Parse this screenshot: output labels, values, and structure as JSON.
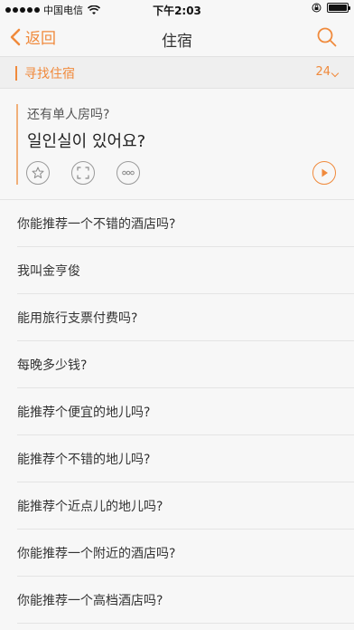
{
  "status_bar": {
    "carrier": "中国电信",
    "time": "下午2:03"
  },
  "nav": {
    "back_label": "返回",
    "title": "住宿"
  },
  "section": {
    "title": "寻找住宿",
    "count": "24"
  },
  "featured": {
    "chinese": "还有单人房吗?",
    "korean": "일인실이 있어요?"
  },
  "list": {
    "items": [
      "你能推荐一个不错的酒店吗?",
      "我叫金亨俊",
      "能用旅行支票付费吗?",
      "每晚多少钱?",
      "能推荐个便宜的地儿吗?",
      "能推荐个不错的地儿吗?",
      "能推荐个近点儿的地儿吗?",
      "你能推荐一个附近的酒店吗?",
      "你能推荐一个高档酒店吗?"
    ]
  },
  "colors": {
    "accent": "#f08a3c",
    "background": "#f7f7f7"
  }
}
